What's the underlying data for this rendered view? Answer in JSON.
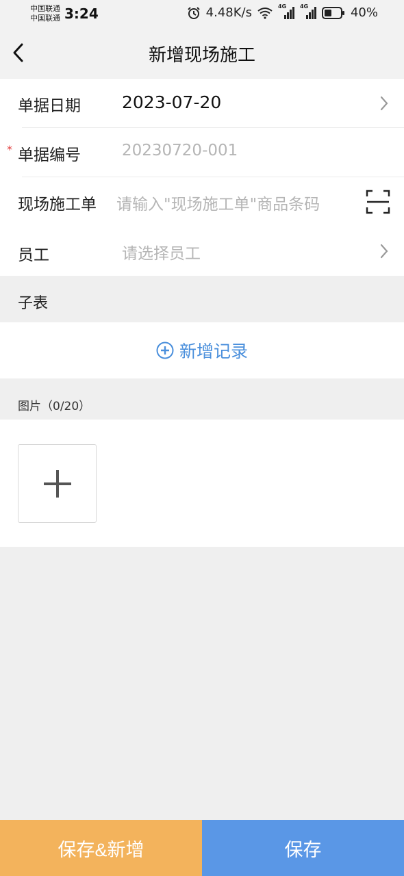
{
  "status_bar": {
    "carrier_1": "中国联通",
    "carrier_2": "中国联通",
    "time": "3:24",
    "net_speed": "4.48K/s",
    "battery": "40%",
    "signal_badge_1": "4G",
    "signal_badge_2": "4G"
  },
  "header": {
    "title": "新增现场施工"
  },
  "form": {
    "doc_date": {
      "label": "单据日期",
      "value": "2023-07-20"
    },
    "doc_number": {
      "required_mark": "*",
      "label": "单据编号",
      "value": "20230720-001"
    },
    "site_order": {
      "label": "现场施工单",
      "placeholder": "请输入\"现场施工单\"商品条码"
    },
    "employee": {
      "label": "员工",
      "placeholder": "请选择员工"
    }
  },
  "subtable": {
    "title": "子表",
    "add_record_label": "新增记录"
  },
  "images": {
    "title": "图片（0/20）"
  },
  "footer": {
    "save_new_label": "保存&新增",
    "save_label": "保存"
  },
  "colors": {
    "accent_blue": "#5a97e6",
    "accent_orange": "#f3b35c",
    "link_blue": "#4a8fdc",
    "required_red": "#e23b3b"
  }
}
